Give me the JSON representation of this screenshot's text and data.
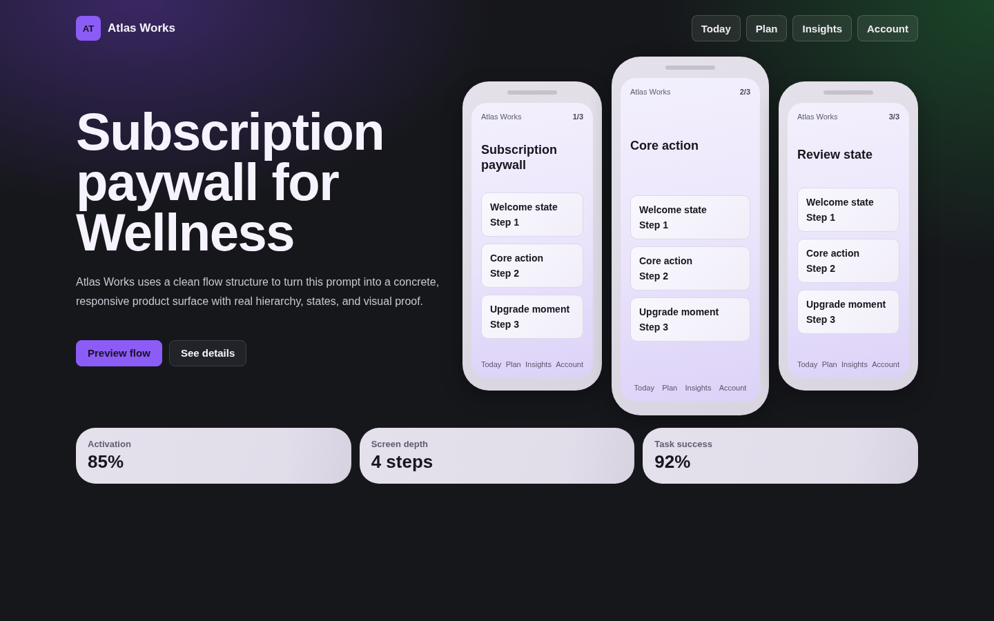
{
  "brand": {
    "badge": "AT",
    "name": "Atlas Works"
  },
  "nav": [
    "Today",
    "Plan",
    "Insights",
    "Account"
  ],
  "hero": {
    "title": "Subscription paywall for Wellness",
    "description": "Atlas Works uses a clean flow structure to turn this prompt into a concrete, responsive product surface with real hierarchy, states, and visual proof.",
    "actions": [
      {
        "label": "Preview flow",
        "kind": "primary"
      },
      {
        "label": "See details",
        "kind": "secondary"
      }
    ]
  },
  "phones": [
    {
      "app_name": "Atlas Works",
      "counter": "1/3",
      "title": "Subscription paywall",
      "featured": false,
      "cards": [
        {
          "title": "Welcome state",
          "step": "Step 1"
        },
        {
          "title": "Core action",
          "step": "Step 2"
        },
        {
          "title": "Upgrade moment",
          "step": "Step 3"
        }
      ],
      "tabs": [
        "Today",
        "Plan",
        "Insights",
        "Account"
      ]
    },
    {
      "app_name": "Atlas Works",
      "counter": "2/3",
      "title": "Core action",
      "featured": true,
      "cards": [
        {
          "title": "Welcome state",
          "step": "Step 1"
        },
        {
          "title": "Core action",
          "step": "Step 2"
        },
        {
          "title": "Upgrade moment",
          "step": "Step 3"
        }
      ],
      "tabs": [
        "Today",
        "Plan",
        "Insights",
        "Account"
      ]
    },
    {
      "app_name": "Atlas Works",
      "counter": "3/3",
      "title": "Review state",
      "featured": false,
      "cards": [
        {
          "title": "Welcome state",
          "step": "Step 1"
        },
        {
          "title": "Core action",
          "step": "Step 2"
        },
        {
          "title": "Upgrade moment",
          "step": "Step 3"
        }
      ],
      "tabs": [
        "Today",
        "Plan",
        "Insights",
        "Account"
      ]
    }
  ],
  "stats": [
    {
      "label": "Activation",
      "value": "85%"
    },
    {
      "label": "Screen depth",
      "value": "4 steps"
    },
    {
      "label": "Task success",
      "value": "92%"
    }
  ]
}
